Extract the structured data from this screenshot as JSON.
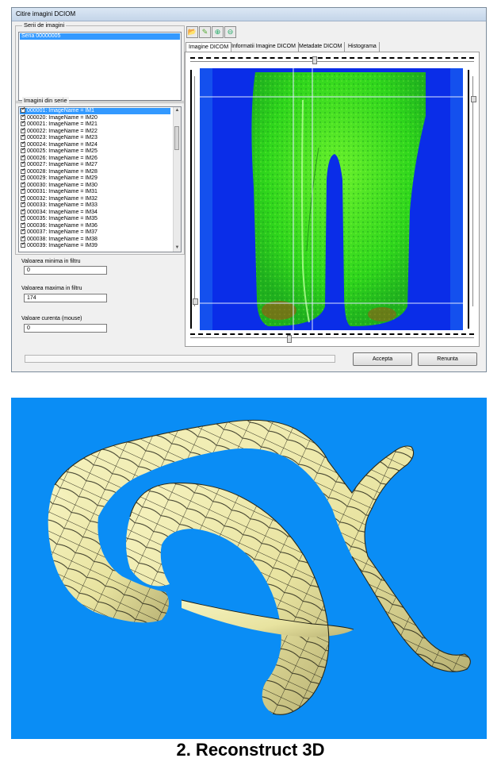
{
  "window": {
    "title": "Citire imagini DCIOM"
  },
  "series_group": {
    "label": "Serii de imagini",
    "items": [
      "Seria 00000005"
    ],
    "selected_index": 0
  },
  "images_group": {
    "label": "Imagini din serie",
    "rows": [
      "000001: ImageName = IM1",
      "000020: ImageName = IM20",
      "000021: ImageName = IM21",
      "000022: ImageName = IM22",
      "000023: ImageName = IM23",
      "000024: ImageName = IM24",
      "000025: ImageName = IM25",
      "000026: ImageName = IM26",
      "000027: ImageName = IM27",
      "000028: ImageName = IM28",
      "000029: ImageName = IM29",
      "000030: ImageName = IM30",
      "000031: ImageName = IM31",
      "000032: ImageName = IM32",
      "000033: ImageName = IM33",
      "000034: ImageName = IM34",
      "000035: ImageName = IM35",
      "000036: ImageName = IM36",
      "000037: ImageName = IM37",
      "000038: ImageName = IM38",
      "000039: ImageName = IM39"
    ],
    "selected_index": 0
  },
  "filters": {
    "min_label": "Valoarea minima in filtru",
    "min_value": "0",
    "max_label": "Valoarea maxima in filtru",
    "max_value": "174",
    "current_label": "Valoare curenta (mouse)",
    "current_value": "0"
  },
  "toolbar": {
    "icons": [
      "open-folder-icon",
      "pencil-icon",
      "zoom-in-icon",
      "zoom-out-icon"
    ]
  },
  "tabs": [
    "Imagine DICOM",
    "Informatii Imagine DICOM",
    "Metadate DICOM",
    "Histograma"
  ],
  "active_tab": 0,
  "buttons": {
    "accept": "Accepta",
    "cancel": "Renunta"
  },
  "colors": {
    "dicom_background": "#0a2de8",
    "dicom_tissue": "#33e81a",
    "render_background": "#0a8df5",
    "vessel_fill": "#f2efb0",
    "selection": "#3399ff"
  },
  "caption": "2. Reconstruct 3D"
}
